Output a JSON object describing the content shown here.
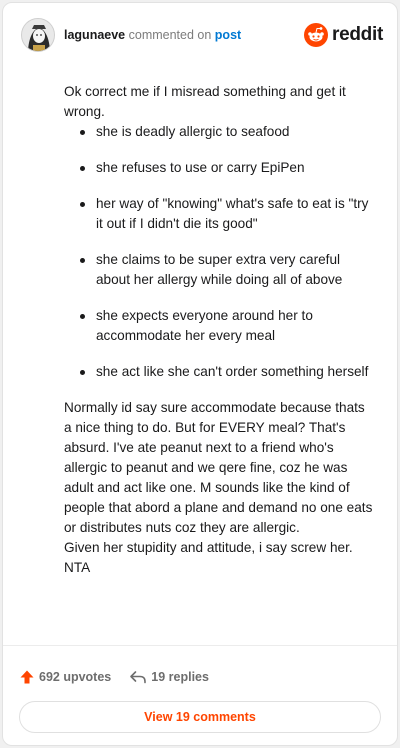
{
  "header": {
    "username": "lagunaeve",
    "action_text": "commented on",
    "target_text": "post",
    "brand": "reddit"
  },
  "comment": {
    "intro": "Ok correct me if I misread something and get it wrong.",
    "bullets": [
      "she is deadly allergic to seafood",
      "she refuses to use or carry EpiPen",
      "her way of \"knowing\" what's safe to eat is \"try it out if I didn't die its good\"",
      "she claims to be super extra very careful about her allergy while doing all of above",
      "she expects everyone around her to accommodate her every meal",
      "she act like she can't order something herself"
    ],
    "paragraph2": "Normally id say sure accommodate because thats a nice thing to do. But for EVERY meal? That's absurd. I've ate peanut next to a friend who's allergic to peanut and we qere fine, coz he was adult and act like one. M sounds like the kind of people that abord a plane and demand no one eats or distributes nuts coz they are allergic.",
    "paragraph3": "Given her stupidity and attitude, i say screw her. NTA"
  },
  "footer": {
    "upvotes": "692 upvotes",
    "replies": "19 replies",
    "view_button": "View 19 comments"
  },
  "colors": {
    "accent": "#ff4500",
    "link": "#0079d3"
  },
  "icons": {
    "upvote": "upvote-arrow-icon",
    "reply": "reply-arrow-icon",
    "brand": "reddit-snoo-icon"
  }
}
